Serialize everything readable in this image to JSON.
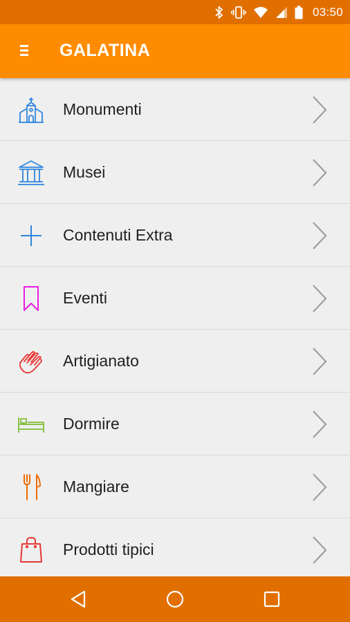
{
  "status_bar": {
    "time": "03:50",
    "icons": [
      "bluetooth-icon",
      "vibrate-icon",
      "wifi-icon",
      "signal-icon",
      "battery-icon"
    ]
  },
  "app_bar": {
    "title": "GALATINA",
    "menu_icon": "hamburger-menu-icon"
  },
  "menu": {
    "items": [
      {
        "label": "Monumenti",
        "icon": "church-icon",
        "color": "#2e86de"
      },
      {
        "label": "Musei",
        "icon": "museum-icon",
        "color": "#2e86de"
      },
      {
        "label": "Contenuti Extra",
        "icon": "plus-icon",
        "color": "#2e86de"
      },
      {
        "label": "Eventi",
        "icon": "bookmark-icon",
        "color": "#e91ee3"
      },
      {
        "label": "Artigianato",
        "icon": "hands-icon",
        "color": "#e53935"
      },
      {
        "label": "Dormire",
        "icon": "bed-icon",
        "color": "#8bc34a"
      },
      {
        "label": "Mangiare",
        "icon": "fork-knife-icon",
        "color": "#ef6c00"
      },
      {
        "label": "Prodotti tipici",
        "icon": "shopping-bag-icon",
        "color": "#e53935"
      }
    ]
  },
  "nav_bar": {
    "buttons": [
      "back-icon",
      "home-icon",
      "recents-icon"
    ]
  },
  "colors": {
    "status_bar": "#e06f00",
    "app_bar": "#ff8c00",
    "nav_bar": "#e06f00",
    "list_background": "#efefef",
    "divider": "#d9d9d9",
    "chevron": "#9e9e9e"
  }
}
